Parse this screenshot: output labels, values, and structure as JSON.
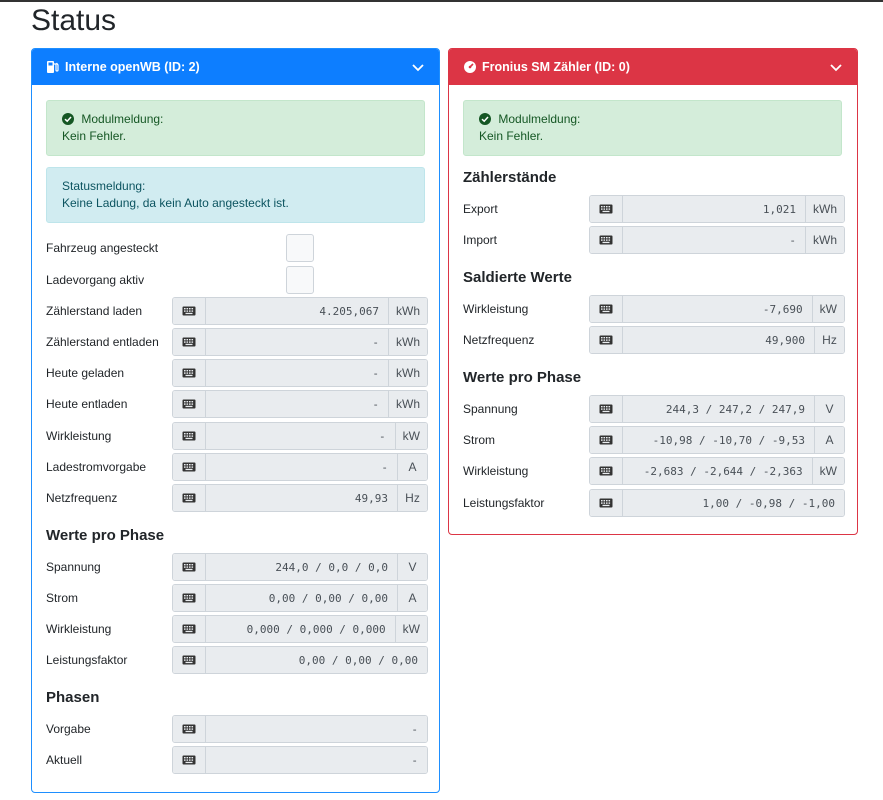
{
  "page": {
    "title": "Status"
  },
  "card_a": {
    "title": "Interne openWB (ID: 2)",
    "modul": {
      "heading": "Modulmeldung:",
      "text": "Kein Fehler."
    },
    "status": {
      "heading": "Statusmeldung:",
      "text": "Keine Ladung, da kein Auto angesteckt ist."
    },
    "checks": [
      {
        "label": "Fahrzeug angesteckt"
      },
      {
        "label": "Ladevorgang aktiv"
      }
    ],
    "fields": [
      {
        "label": "Zählerstand laden",
        "value": "4.205,067",
        "unit": "kWh"
      },
      {
        "label": "Zählerstand entladen",
        "value": "-",
        "unit": "kWh"
      },
      {
        "label": "Heute geladen",
        "value": "-",
        "unit": "kWh"
      },
      {
        "label": "Heute entladen",
        "value": "-",
        "unit": "kWh"
      },
      {
        "label": "Wirkleistung",
        "value": "-",
        "unit": "kW"
      },
      {
        "label": "Ladestromvorgabe",
        "value": "-",
        "unit": "A"
      },
      {
        "label": "Netzfrequenz",
        "value": "49,93",
        "unit": "Hz"
      }
    ],
    "phase_heading": "Werte pro Phase",
    "phase_fields": [
      {
        "label": "Spannung",
        "value": "244,0 / 0,0 / 0,0",
        "unit": "V"
      },
      {
        "label": "Strom",
        "value": "0,00 / 0,00 / 0,00",
        "unit": "A"
      },
      {
        "label": "Wirkleistung",
        "value": "0,000 / 0,000 / 0,000",
        "unit": "kW"
      },
      {
        "label": "Leistungsfaktor",
        "value": "0,00 / 0,00 / 0,00",
        "unit": ""
      }
    ],
    "phasen_heading": "Phasen",
    "phasen_fields": [
      {
        "label": "Vorgabe",
        "value": "-"
      },
      {
        "label": "Aktuell",
        "value": "-"
      }
    ]
  },
  "card_b": {
    "title": "Fronius SM Zähler (ID: 0)",
    "modul": {
      "heading": "Modulmeldung:",
      "text": "Kein Fehler."
    },
    "zaehler_heading": "Zählerstände",
    "zaehler_fields": [
      {
        "label": "Export",
        "value": "1,021",
        "unit": "kWh"
      },
      {
        "label": "Import",
        "value": "-",
        "unit": "kWh"
      }
    ],
    "saldiert_heading": "Saldierte Werte",
    "saldiert_fields": [
      {
        "label": "Wirkleistung",
        "value": "-7,690",
        "unit": "kW"
      },
      {
        "label": "Netzfrequenz",
        "value": "49,900",
        "unit": "Hz"
      }
    ],
    "phase_heading": "Werte pro Phase",
    "phase_fields": [
      {
        "label": "Spannung",
        "value": "244,3 / 247,2 / 247,9",
        "unit": "V"
      },
      {
        "label": "Strom",
        "value": "-10,98 / -10,70 / -9,53",
        "unit": "A"
      },
      {
        "label": "Wirkleistung",
        "value": "-2,683 / -2,644 / -2,363",
        "unit": "kW"
      },
      {
        "label": "Leistungsfaktor",
        "value": "1,00 / -0,98 / -1,00",
        "unit": ""
      }
    ]
  },
  "colors": {
    "primary": "#0d7eff",
    "danger": "#dc3545",
    "success_bg": "#d4edda",
    "info_bg": "#d1ecf1"
  },
  "icons": {
    "charger": "charging-station-icon",
    "meter": "tachometer-icon",
    "keyboard": "keyboard-icon",
    "chevron": "chevron-down-icon",
    "check": "check-circle-icon"
  }
}
